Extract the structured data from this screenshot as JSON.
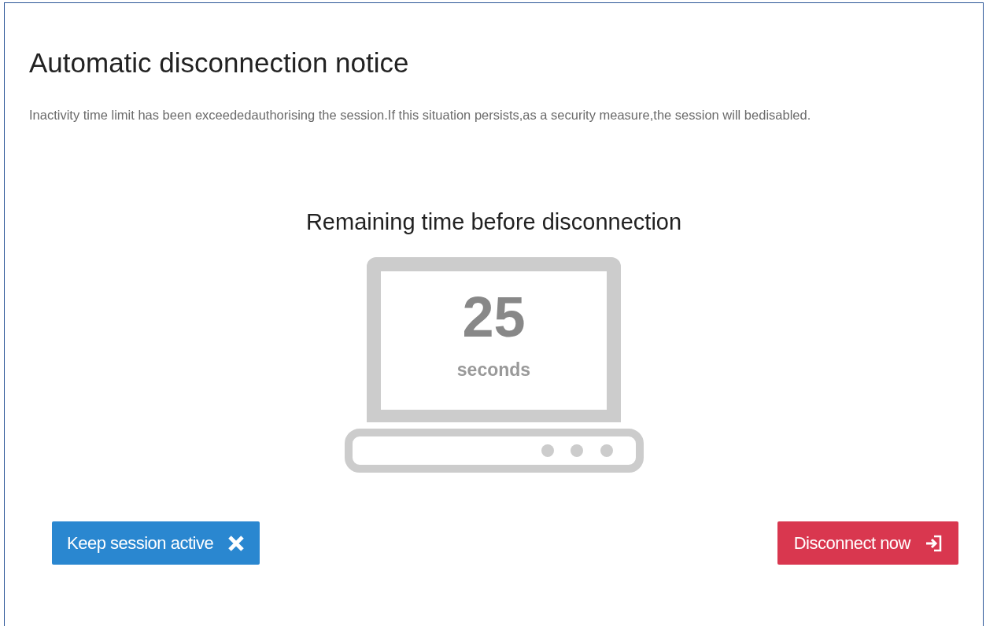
{
  "dialog": {
    "title": "Automatic disconnection notice",
    "message": "Inactivity time limit has been exceededauthorising the session.If this situation persists,as a security measure,the session will bedisabled.",
    "countdown": {
      "heading": "Remaining time before disconnection",
      "value": "25",
      "unit": "seconds"
    },
    "buttons": [
      {
        "label": "Keep session active",
        "kind": "keep"
      },
      {
        "label": "Disconnect now",
        "kind": "disconnect"
      }
    ]
  }
}
